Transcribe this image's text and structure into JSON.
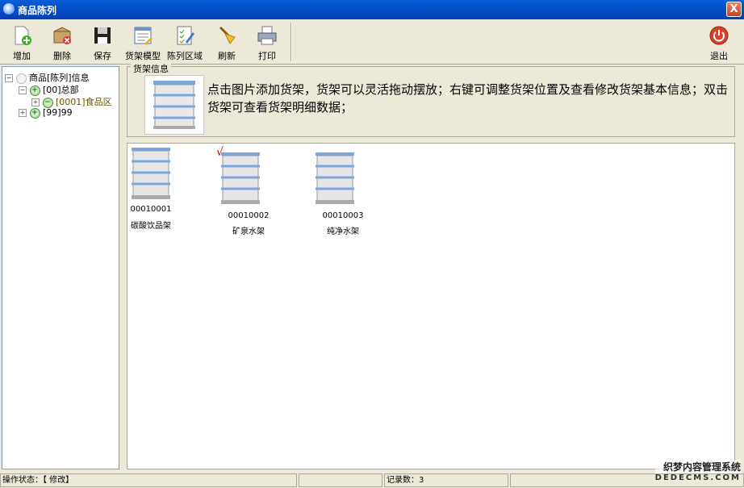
{
  "window": {
    "title": "商品陈列",
    "close_label": "X"
  },
  "toolbar": {
    "add": "增加",
    "delete": "删除",
    "save": "保存",
    "shelf_model": "货架模型",
    "display_area": "陈列区域",
    "refresh": "刷新",
    "print": "打印",
    "exit": "退出"
  },
  "tree": {
    "root": "商品[陈列]信息",
    "n1": "[00]总部",
    "n2": "[0001]食品区",
    "n3": "[99]99",
    "plus": "+",
    "minus": "−",
    "expanded": "−",
    "collapsed": "+"
  },
  "info": {
    "legend": "货架信息",
    "text": "点击图片添加货架，货架可以灵活拖动摆放；右键可调整货架位置及查看修改货架基本信息；双击货架可查看货架明细数据；"
  },
  "shelves": [
    {
      "code": "00010001",
      "name": "碳酸饮品架"
    },
    {
      "code": "00010002",
      "name": "矿泉水架",
      "checked": true
    },
    {
      "code": "00010003",
      "name": "纯净水架"
    }
  ],
  "check_mark": "√",
  "status": {
    "op_state": "操作状态：【 修改】",
    "record_count": "记录数：3"
  },
  "watermark": {
    "line1": "织梦内容管理系统",
    "line2": "DEDECMS.COM"
  },
  "colors": {
    "title_bar": "#0450c8",
    "shelf_blue": "#7aa7e0",
    "check": "#dd0000"
  }
}
